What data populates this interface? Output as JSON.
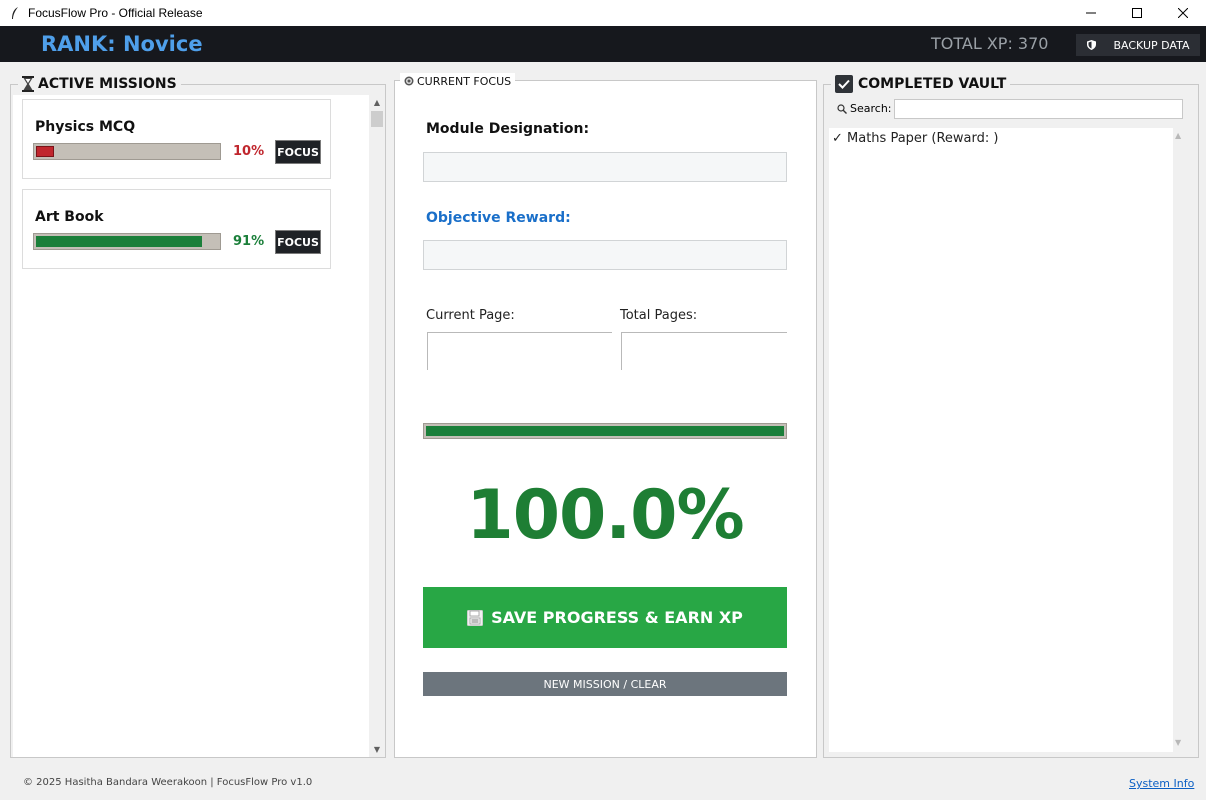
{
  "window": {
    "title": "FocusFlow Pro - Official Release",
    "icon": "feather-icon",
    "controls": [
      "minimize",
      "maximize",
      "close"
    ]
  },
  "header": {
    "rank": "RANK: Novice",
    "total_xp": "TOTAL XP: 370",
    "backup_label": "BACKUP DATA",
    "backup_icon": "shield-icon"
  },
  "active_missions": {
    "title": "ACTIVE MISSIONS",
    "icon": "hourglass-icon",
    "items": [
      {
        "name": "Physics MCQ",
        "percent_label": "10%",
        "progress": 0.1,
        "color": "#c0262d",
        "button": "FOCUS"
      },
      {
        "name": "Art Book",
        "percent_label": "91%",
        "progress": 0.91,
        "color": "#1b7f3a",
        "button": "FOCUS"
      }
    ]
  },
  "current_focus": {
    "title": "CURRENT FOCUS",
    "icon": "target-icon",
    "module_label": "Module Designation:",
    "module_value": "",
    "reward_label": "Objective Reward:",
    "reward_value": "",
    "current_page_label": "Current Page:",
    "current_page_value": "",
    "total_pages_label": "Total Pages:",
    "total_pages_value": "",
    "progress": 1.0,
    "percent_label": "100.0%",
    "save_label": "SAVE PROGRESS & EARN XP",
    "save_icon": "floppy-icon",
    "clear_label": "NEW MISSION / CLEAR"
  },
  "completed_vault": {
    "title": "COMPLETED VAULT",
    "icon": "checkbox-icon",
    "search_label": "Search:",
    "search_value": "",
    "items": [
      {
        "text": "✓ Maths Paper (Reward: )"
      }
    ]
  },
  "footer": {
    "copyright": "© 2025 Hasitha Bandara Weerakoon | FocusFlow Pro v1.0",
    "link": "System Info"
  },
  "colors": {
    "accent_blue": "#4f9fea",
    "header_bg": "#16181d",
    "green": "#28a745",
    "dark_green": "#1e7e34",
    "red": "#c0262d",
    "reward_blue": "#1a6fc9",
    "gray_button": "#6c757d"
  }
}
